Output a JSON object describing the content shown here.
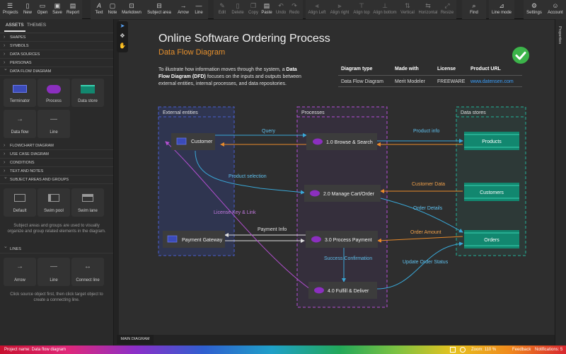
{
  "toolbar": {
    "left": [
      {
        "label": "Projects",
        "icon": "menu-icon"
      },
      {
        "label": "New",
        "icon": "new-doc-icon"
      },
      {
        "label": "Open",
        "icon": "folder-icon"
      },
      {
        "label": "Save",
        "icon": "save-icon"
      },
      {
        "label": "Report",
        "icon": "report-icon"
      }
    ],
    "insert": [
      {
        "label": "Text",
        "icon": "text-icon"
      },
      {
        "label": "Note",
        "icon": "note-icon"
      },
      {
        "label": "Markdown",
        "icon": "markdown-icon"
      },
      {
        "label": "Subject area",
        "icon": "subject-area-icon"
      },
      {
        "label": "Arrow",
        "icon": "arrow-icon"
      },
      {
        "label": "Line",
        "icon": "line-icon"
      }
    ],
    "edit": [
      {
        "label": "Edit",
        "icon": "pencil-icon"
      },
      {
        "label": "Delete",
        "icon": "trash-icon"
      },
      {
        "label": "Copy",
        "icon": "copy-icon"
      },
      {
        "label": "Paste",
        "icon": "paste-icon"
      },
      {
        "label": "Undo",
        "icon": "undo-icon"
      },
      {
        "label": "Redo",
        "icon": "redo-icon"
      }
    ],
    "align": [
      {
        "label": "Align Left",
        "icon": "align-left-icon"
      },
      {
        "label": "Align right",
        "icon": "align-right-icon"
      },
      {
        "label": "Align top",
        "icon": "align-top-icon"
      },
      {
        "label": "Align bottom",
        "icon": "align-bottom-icon"
      },
      {
        "label": "Vertical",
        "icon": "vertical-icon"
      },
      {
        "label": "Horizontal",
        "icon": "horizontal-icon"
      },
      {
        "label": "Resize",
        "icon": "resize-icon"
      }
    ],
    "find": {
      "label": "Find",
      "icon": "search-icon"
    },
    "line_mode": {
      "label": "Line mode",
      "icon": "line-mode-icon"
    },
    "settings": {
      "label": "Settings",
      "icon": "gear-icon"
    },
    "account": {
      "label": "Account",
      "icon": "user-icon"
    }
  },
  "sidebar": {
    "tabs": [
      "ASSETS",
      "THEMES"
    ],
    "sections_top": [
      "SHAPES",
      "SYMBOLS",
      "DATA SOURCES",
      "PERSONAS"
    ],
    "dfd_header": "DATA FLOW DIAGRAM",
    "dfd_tiles": [
      "Terminator",
      "Process",
      "Data store",
      "Data flow",
      "Line"
    ],
    "sections_mid": [
      "FLOWCHART DIAGRAM",
      "USE CASE DIAGRAM",
      "CONDITIONS",
      "TEXT AND NOTES"
    ],
    "subject_header": "SUBJECT AREAS AND GROUPS",
    "subject_tiles": [
      "Default",
      "Swim pool",
      "Swim lane"
    ],
    "subject_hint": "Subject areas and groups are used to visually organize and group related elements in the diagram.",
    "lines_header": "LINES",
    "line_tiles": [
      "Arrow",
      "Line",
      "Connect line"
    ],
    "lines_hint": "Click source object first, then click target object to create a connecting line."
  },
  "doc": {
    "title": "Online Software Ordering Process",
    "subtitle": "Data Flow Diagram",
    "intro_pre": "To illustrate how information moves through the system, a ",
    "intro_bold": "Data Flow Diagram (DFD)",
    "intro_post": " focuses on the inputs and outputs between external entities, internal processes, and data repositories.",
    "meta_headers": [
      "Diagram type",
      "Made with",
      "License",
      "Product URL"
    ],
    "meta_values": [
      "Data Flow Diagram",
      "Merit Modeler",
      "FREEWARE",
      "www.datensen.com"
    ]
  },
  "diagram": {
    "groups": [
      "External entities",
      "Processes",
      "Data stores"
    ],
    "entities": [
      "Customer",
      "Payment Gateway"
    ],
    "processes": [
      "1.0 Browse & Search",
      "2.0 Manage Cart/Order",
      "3.0 Process Payment",
      "4.0 Fulfill & Deliver"
    ],
    "stores": [
      "Products",
      "Customers",
      "Orders"
    ],
    "flows": [
      "Query",
      "Product info",
      "Product selection",
      "Customer Data",
      "Order Details",
      "License Key & Link",
      "Payment Info",
      "Order Amount",
      "Success Confirmation",
      "Update Order Status"
    ]
  },
  "colors": {
    "entity": "#3b4bb8",
    "process": "#8b2fbf",
    "store": "#12876f",
    "accent": "#e8912d",
    "flow_blue": "#39a7d6",
    "flow_orange": "#e88a2a",
    "flow_purple": "#b34fd0"
  },
  "bottom_tab": "MAIN DIAGRAM",
  "right_rail": "Properties",
  "status": {
    "project": "Project name: Data flow diagram",
    "zoom": "Zoom: 110 %",
    "feedback": "Feedback",
    "notifications": "Notifications: 5"
  }
}
